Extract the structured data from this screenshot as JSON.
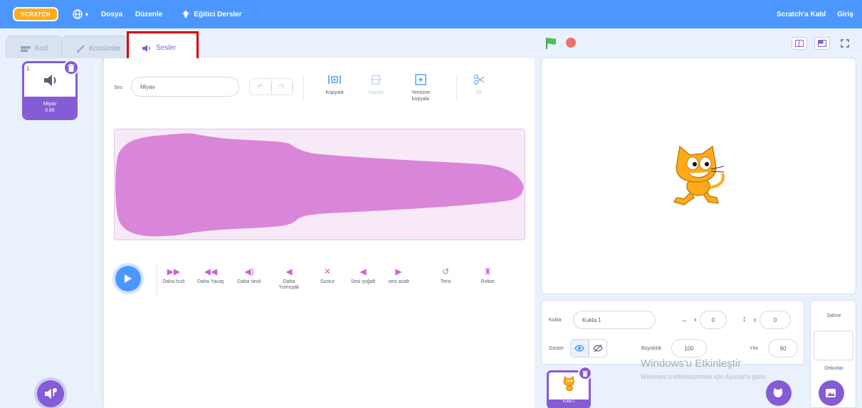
{
  "menubar": {
    "logo": "SCRATCH",
    "dosya": "Dosya",
    "duzenle": "Düzenle",
    "tutorials": "Eğitici Dersler",
    "join": "Scratch'a Katıl",
    "signin": "Giriş"
  },
  "tabs": {
    "code": "Kod",
    "costumes": "Kostümler",
    "sounds": "Sesler"
  },
  "soundlist": {
    "tile_number": "1",
    "tile_name": "Miyav",
    "tile_duration": "0.85"
  },
  "editor": {
    "sound_label": "Ses",
    "sound_name": "Miyav",
    "copy": "Kopyala",
    "paste": "Yapıştır",
    "copy_new_line1": "Yenisine",
    "copy_new_line2": "kopyala",
    "delete": "Sil"
  },
  "effects": [
    {
      "label": "Daha hızlı"
    },
    {
      "label": "Daha Yavaş"
    },
    {
      "label": "Daha sesli"
    },
    {
      "label": "Daha Yumuşak"
    },
    {
      "label": "Sustur"
    },
    {
      "label": "Sesi çoğalt"
    },
    {
      "label": "sesi azalt"
    },
    {
      "label": "Tersi"
    },
    {
      "label": "Robot"
    }
  ],
  "sprite_info": {
    "sprite_label": "Kukla",
    "sprite_name": "Kukla 1",
    "x_label": "x",
    "x_value": "0",
    "y_label": "y",
    "y_value": "0",
    "show_label": "Göster",
    "size_label": "Büyüklük",
    "size_value": "100",
    "direction_label": "Yön",
    "direction_value": "90",
    "thumb_name": "Kukla 1"
  },
  "stage_panel": {
    "title": "Sahne",
    "backdrops_label": "Dekorlar"
  },
  "watermark": {
    "line1": "Windows'u Etkinleştir",
    "line2": "Windows'u etkinleştirmek için Ayarlar'a gidin."
  },
  "colors": {
    "menubar": "#4c97ff",
    "sound_accent": "#855cd6",
    "effect_icon": "#cf63cf",
    "waveform": "#cf63cf",
    "cat_orange": "#ffab19"
  }
}
